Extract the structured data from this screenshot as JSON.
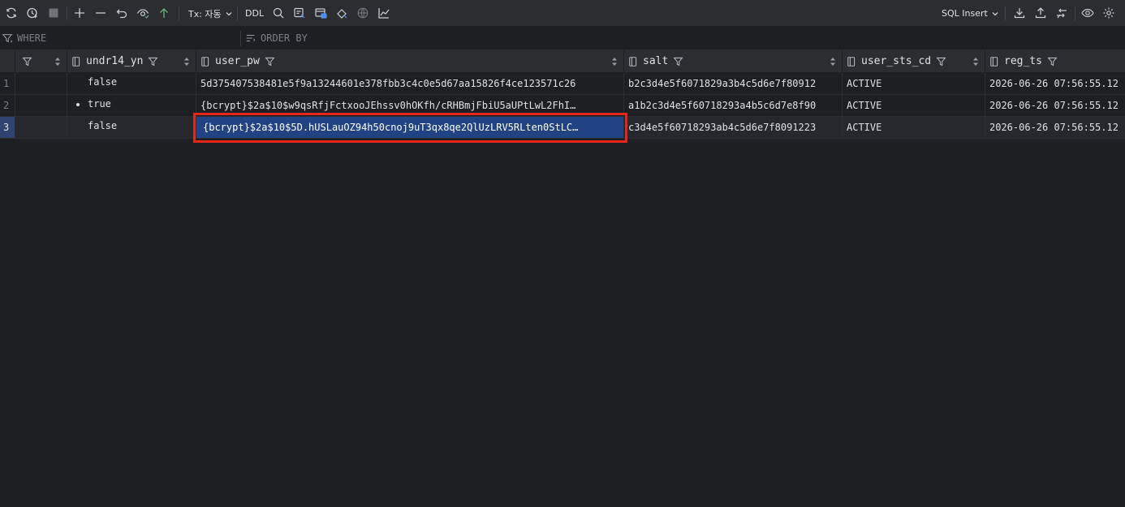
{
  "toolbar": {
    "tx_label": "Tx: 자동",
    "ddl_label": "DDL",
    "sql_insert_label": "SQL Insert",
    "add_row_color": "#6aab73"
  },
  "filters": {
    "where_label": "WHERE",
    "order_by_label": "ORDER BY"
  },
  "columns": [
    {
      "name": ""
    },
    {
      "name": "undr14_yn"
    },
    {
      "name": "user_pw"
    },
    {
      "name": "salt"
    },
    {
      "name": "user_sts_cd"
    },
    {
      "name": "reg_ts"
    }
  ],
  "rows": [
    {
      "num": "1",
      "col0": "",
      "undr14_yn": "false",
      "user_pw": "5d375407538481e5f9a13244601e378fbb3c4c0e5d67aa15826f4ce123571c26",
      "salt": "b2c3d4e5f6071829a3b4c5d6e7f80912",
      "user_sts_cd": "ACTIVE",
      "reg_ts": "2026-06-26 07:56:55.12"
    },
    {
      "num": "2",
      "col0": "",
      "undr14_yn": "true",
      "user_pw": "{bcrypt}$2a$10$w9qsRfjFctxooJEhssv0hOKfh/cRHBmjFbiU5aUPtLwL2FhI…",
      "salt": "a1b2c3d4e5f60718293a4b5c6d7e8f90",
      "user_sts_cd": "ACTIVE",
      "reg_ts": "2026-06-26 07:56:55.12"
    },
    {
      "num": "3",
      "col0": "",
      "undr14_yn": "false",
      "user_pw": "{bcrypt}$2a$10$5D.hUSLauOZ94h50cnoj9uT3qx8qe2QlUzLRV5RLten0StLC…",
      "salt": "c3d4e5f60718293ab4c5d6e7f8091223",
      "user_sts_cd": "ACTIVE",
      "reg_ts": "2026-06-26 07:56:55.12"
    }
  ],
  "selection": {
    "row": 3,
    "column": "user_pw",
    "highlight_color": "#e5261c"
  }
}
